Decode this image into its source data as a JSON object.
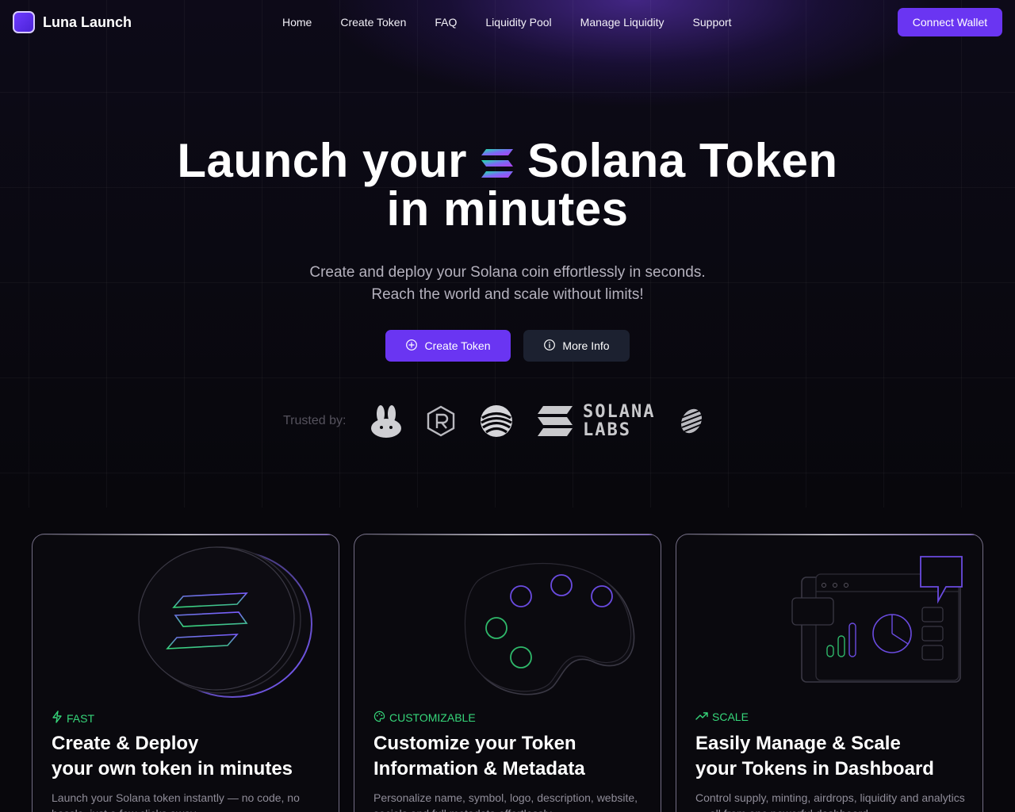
{
  "nav": {
    "brand": "Luna Launch",
    "links": [
      "Home",
      "Create Token",
      "FAQ",
      "Liquidity Pool",
      "Manage Liquidity",
      "Support"
    ],
    "connect_label": "Connect Wallet"
  },
  "hero": {
    "title_part1": "Launch your",
    "title_part2": "Solana Token",
    "title_line2": "in minutes",
    "subtitle_line1": "Create and deploy your Solana coin effortlessly in seconds.",
    "subtitle_line2": "Reach the world and scale without limits!",
    "primary_button": "Create Token",
    "secondary_button": "More Info"
  },
  "trusted": {
    "label": "Trusted by:",
    "partners": [
      {
        "icon": "pancakeswap-bunny-icon"
      },
      {
        "icon": "raydium-hexagon-icon"
      },
      {
        "icon": "orb-stripes-icon"
      },
      {
        "icon": "solana-labs-logo",
        "text_line1": "SOLANA",
        "text_line2": "LABS"
      },
      {
        "icon": "leaf-stripes-icon"
      }
    ]
  },
  "cards": [
    {
      "tag": "FAST",
      "tag_icon": "lightning-icon",
      "title_line1": "Create & Deploy",
      "title_line2": "your own token in minutes",
      "description": "Launch your Solana token instantly — no code, no hassle, just a few clicks away."
    },
    {
      "tag": "CUSTOMIZABLE",
      "tag_icon": "palette-icon",
      "title_line1": "Customize your Token",
      "title_line2": "Information & Metadata",
      "description": "Personalize name, symbol, logo, description, website, socials and full metadata effortlessly."
    },
    {
      "tag": "SCALE",
      "tag_icon": "trending-up-icon",
      "title_line1": "Easily Manage & Scale",
      "title_line2": "your Tokens in Dashboard",
      "description": "Control supply, minting, airdrops, liquidity and analytics — all from one powerful dashboard."
    }
  ],
  "colors": {
    "accent": "#6a35f2",
    "tag_green": "#36d67a",
    "background": "#08070c"
  }
}
